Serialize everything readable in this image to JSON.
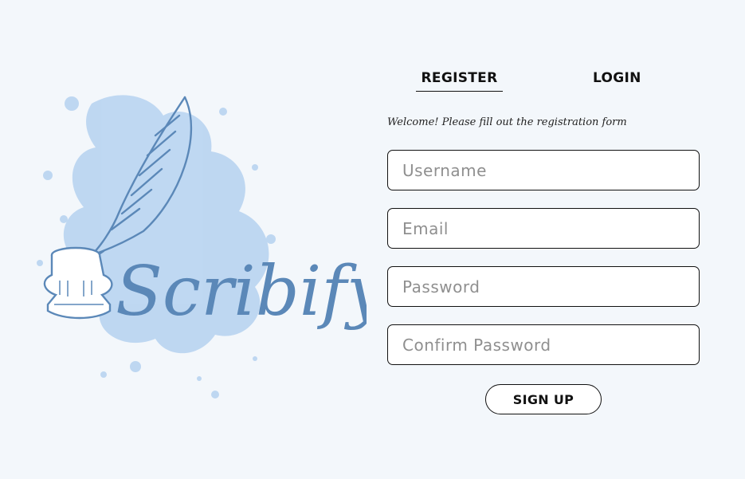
{
  "theme": {
    "background": "#f3f7fb",
    "accent": "#5b88b8",
    "splash": "#b9d4f1"
  },
  "logo": {
    "text": "Scribify",
    "icon": "quill-inkwell-icon"
  },
  "tabs": [
    {
      "label": "REGISTER",
      "active": true
    },
    {
      "label": "LOGIN",
      "active": false
    }
  ],
  "form": {
    "welcome": "Welcome! Please fill out the registration form",
    "fields": [
      {
        "placeholder": "Username",
        "value": ""
      },
      {
        "placeholder": "Email",
        "value": ""
      },
      {
        "placeholder": "Password",
        "value": ""
      },
      {
        "placeholder": "Confirm Password",
        "value": ""
      }
    ],
    "submit_label": "SIGN UP"
  }
}
